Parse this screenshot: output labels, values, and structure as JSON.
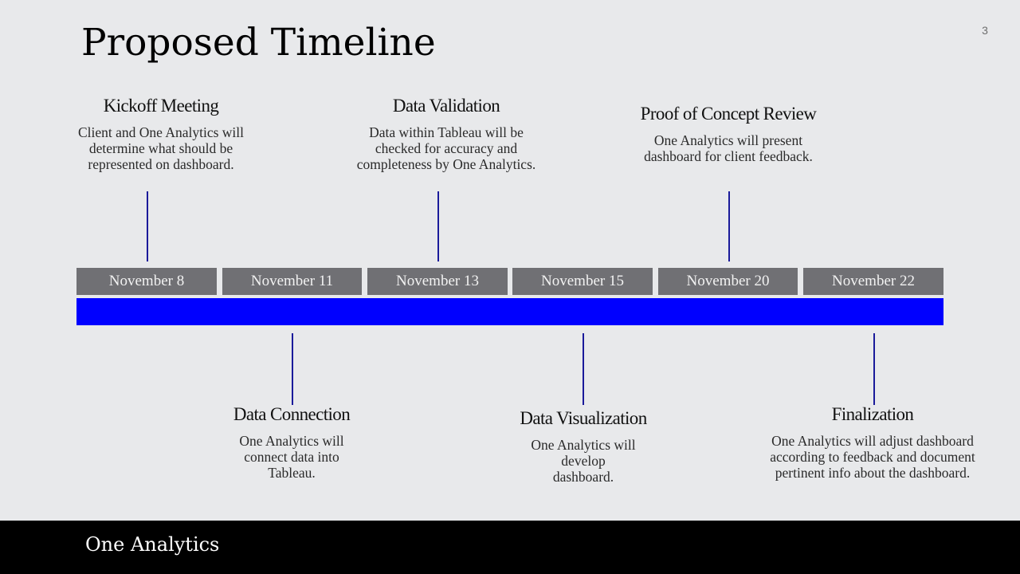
{
  "slide": {
    "title": "Proposed Timeline",
    "page_number": "3",
    "footer_brand": "One Analytics",
    "colors": {
      "background": "#e8e9eb",
      "timeline_bar": "#0000ff",
      "date_box": "#707074",
      "connector": "#1a1a9a",
      "footer": "#000000"
    }
  },
  "dates": [
    "November 8",
    "November 11",
    "November 13",
    "November 15",
    "November 20",
    "November 22"
  ],
  "milestones": [
    {
      "date": "November 8",
      "position": "above",
      "title": "Kickoff Meeting",
      "description": "Client and One Analytics will determine what should be represented on dashboard."
    },
    {
      "date": "November 11",
      "position": "below",
      "title": "Data Connection",
      "description": "One Analytics will connect data into Tableau."
    },
    {
      "date": "November 13",
      "position": "above",
      "title": "Data Validation",
      "description": "Data within Tableau will be checked for accuracy and completeness by One Analytics."
    },
    {
      "date": "November 15",
      "position": "below",
      "title": "Data Visualization",
      "description": "One Analytics will develop dashboard."
    },
    {
      "date": "November 20",
      "position": "above",
      "title": "Proof of Concept Review",
      "description": "One Analytics will present dashboard for client feedback."
    },
    {
      "date": "November 22",
      "position": "below",
      "title": "Finalization",
      "description": "One Analytics will adjust dashboard according to feedback and document pertinent info about the dashboard."
    }
  ]
}
